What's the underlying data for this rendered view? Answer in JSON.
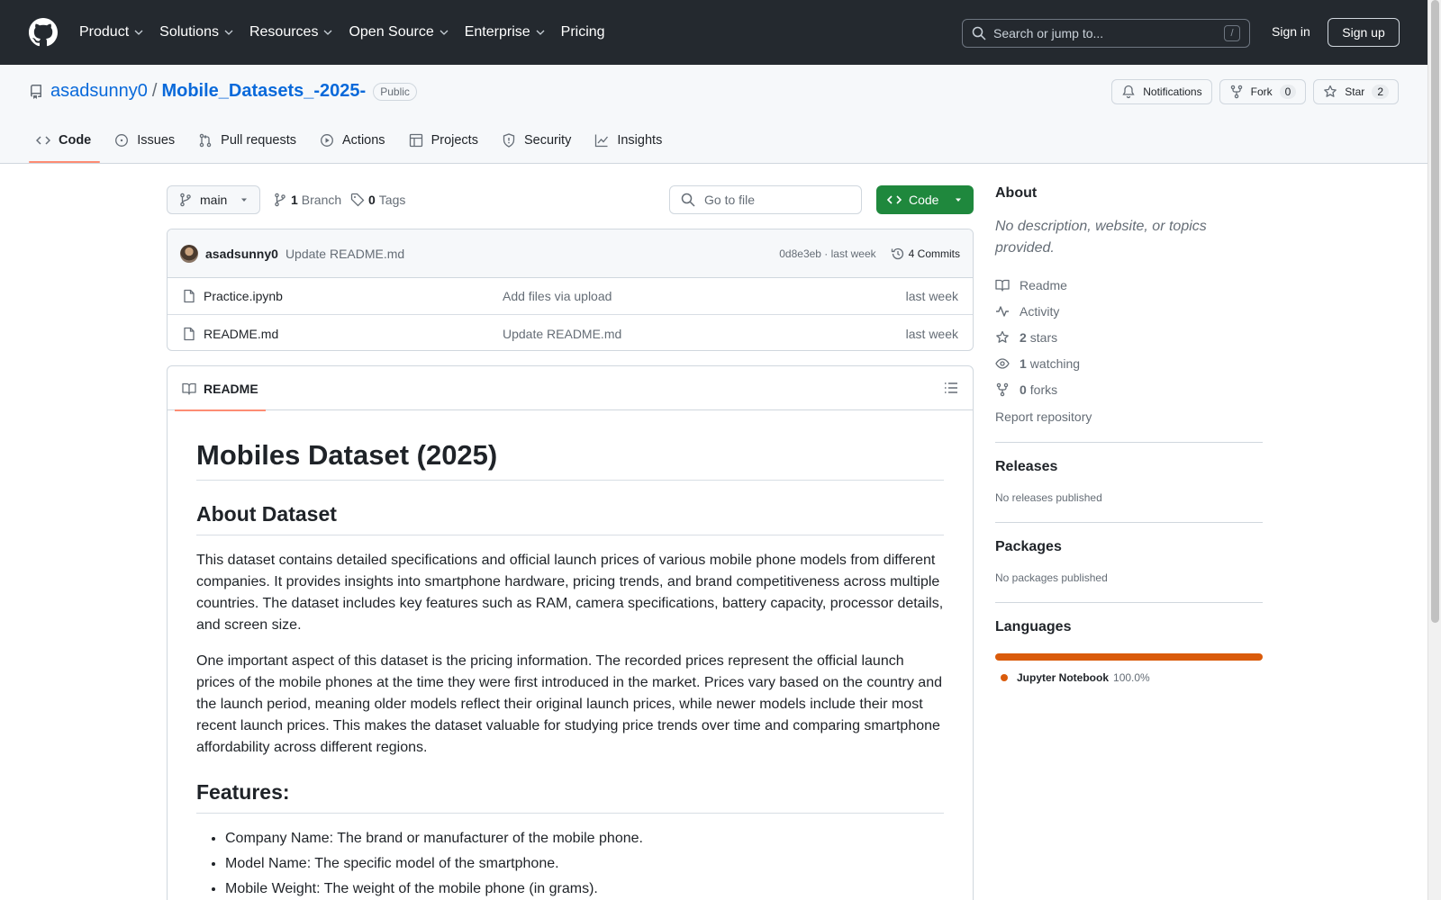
{
  "header": {
    "nav": [
      "Product",
      "Solutions",
      "Resources",
      "Open Source",
      "Enterprise",
      "Pricing"
    ],
    "search_placeholder": "Search or jump to...",
    "search_key": "/",
    "sign_in": "Sign in",
    "sign_up": "Sign up"
  },
  "repo": {
    "owner": "asadsunny0",
    "separator": "/",
    "name": "Mobile_Datasets_-2025-",
    "visibility": "Public",
    "actions": {
      "notifications": "Notifications",
      "fork": "Fork",
      "fork_count": "0",
      "star": "Star",
      "star_count": "2"
    },
    "tabs": [
      "Code",
      "Issues",
      "Pull requests",
      "Actions",
      "Projects",
      "Security",
      "Insights"
    ]
  },
  "branchbar": {
    "branch": "main",
    "branch_count": "1",
    "branch_label": "Branch",
    "tag_count": "0",
    "tag_label": "Tags",
    "goto_placeholder": "Go to file",
    "code_button": "Code"
  },
  "commit": {
    "author": "asadsunny0",
    "message": "Update README.md",
    "meta": "0d8e3eb · last week",
    "commits": "4 Commits"
  },
  "files": [
    {
      "name": "Practice.ipynb",
      "message": "Add files via upload",
      "time": "last week"
    },
    {
      "name": "README.md",
      "message": "Update README.md",
      "time": "last week"
    }
  ],
  "readme": {
    "tab": "README",
    "title": "Mobiles Dataset (2025)",
    "about_heading": "About Dataset",
    "p1": "This dataset contains detailed specifications and official launch prices of various mobile phone models from different companies. It provides insights into smartphone hardware, pricing trends, and brand competitiveness across multiple countries. The dataset includes key features such as RAM, camera specifications, battery capacity, processor details, and screen size.",
    "p2": "One important aspect of this dataset is the pricing information. The recorded prices represent the official launch prices of the mobile phones at the time they were first introduced in the market. Prices vary based on the country and the launch period, meaning older models reflect their original launch prices, while newer models include their most recent launch prices. This makes the dataset valuable for studying price trends over time and comparing smartphone affordability across different regions.",
    "features_heading": "Features:",
    "features": [
      "Company Name: The brand or manufacturer of the mobile phone.",
      "Model Name: The specific model of the smartphone.",
      "Mobile Weight: The weight of the mobile phone (in grams)."
    ]
  },
  "sidebar": {
    "about_heading": "About",
    "about_desc": "No description, website, or topics provided.",
    "readme": "Readme",
    "activity": "Activity",
    "stars_count": "2",
    "stars_label": "stars",
    "watching_count": "1",
    "watching_label": "watching",
    "forks_count": "0",
    "forks_label": "forks",
    "report": "Report repository",
    "releases_heading": "Releases",
    "releases_empty": "No releases published",
    "packages_heading": "Packages",
    "packages_empty": "No packages published",
    "languages_heading": "Languages",
    "language_name": "Jupyter Notebook",
    "language_pct": "100.0%",
    "language_color": "#da5b0b"
  }
}
